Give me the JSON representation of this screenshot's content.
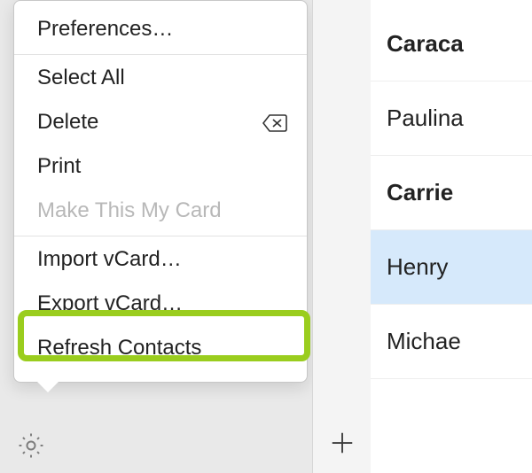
{
  "menu": {
    "preferences": "Preferences…",
    "select_all": "Select All",
    "delete": "Delete",
    "print": "Print",
    "make_my_card": "Make This My Card",
    "import_vcard": "Import vCard…",
    "export_vcard": "Export vCard…",
    "refresh": "Refresh Contacts"
  },
  "contacts": {
    "items": [
      {
        "label": "Caraca",
        "bold": true,
        "selected": false
      },
      {
        "label": "Paulina",
        "bold": false,
        "selected": false
      },
      {
        "label": "Carrie",
        "bold": true,
        "selected": false
      },
      {
        "label": "Henry",
        "bold": false,
        "selected": true
      },
      {
        "label": "Michae",
        "bold": false,
        "selected": false
      }
    ]
  },
  "highlight": {
    "target": "export_vcard",
    "color": "#9acd1e"
  },
  "icons": {
    "gear": "gear-icon",
    "delete_back": "delete-back-icon",
    "plus": "plus-icon"
  }
}
